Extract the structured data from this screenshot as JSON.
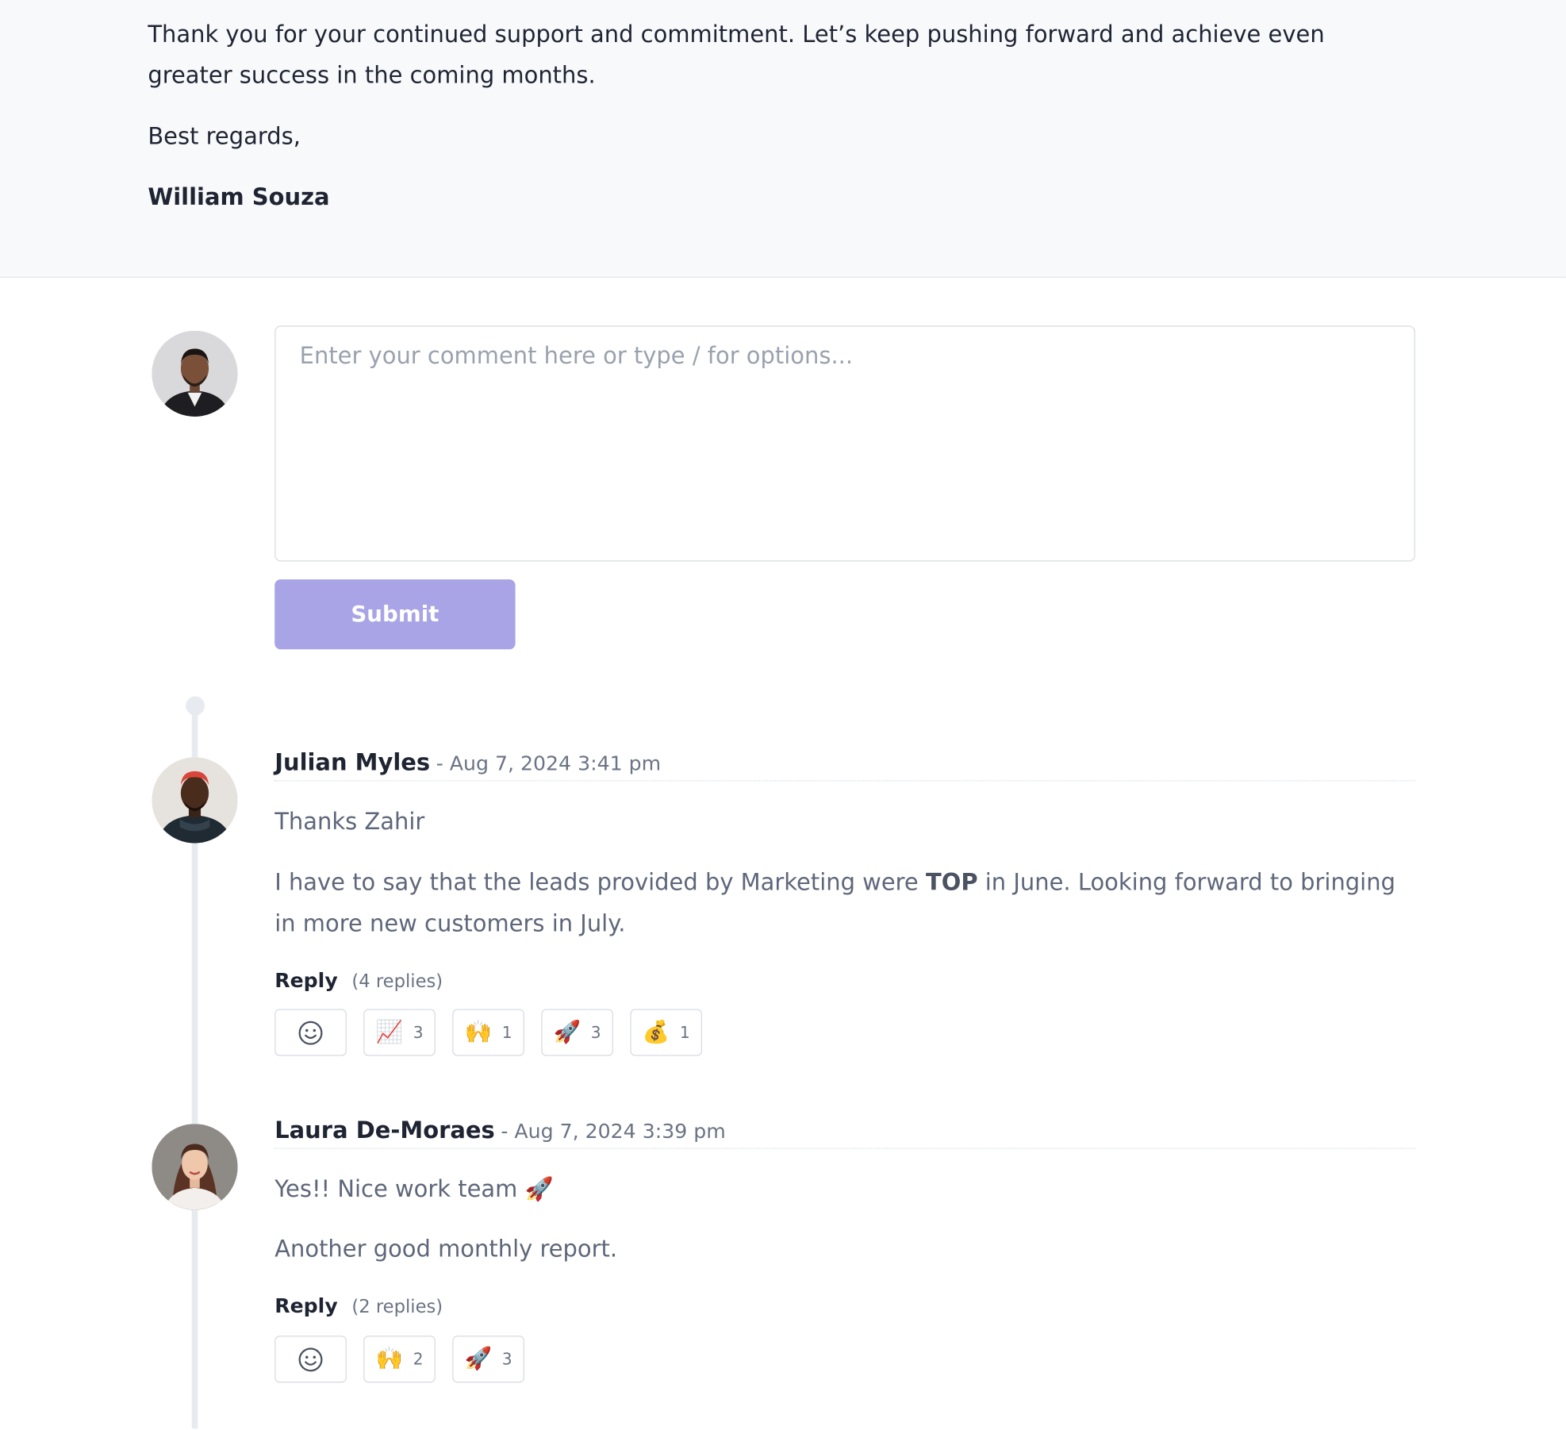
{
  "email": {
    "closing_paragraph": "Thank you for your continued support and commitment. Let’s keep pushing forward and achieve even greater success in the coming months.",
    "regards": "Best regards,",
    "signature": "William Souza"
  },
  "compose": {
    "placeholder": "Enter your comment here or type / for options...",
    "value": "",
    "submit_label": "Submit"
  },
  "comments": [
    {
      "author": "Julian Myles",
      "time": "- Aug 7, 2024 3:41 pm",
      "line1": "Thanks Zahir",
      "line2_before": "I have to say that the leads provided by Marketing were ",
      "line2_bold": "TOP",
      "line2_after": " in June. Looking forward to bringing in more new customers in July.",
      "reply_label": "Reply",
      "replies": "(4 replies)",
      "reactions": [
        {
          "icon": "smile-add-icon",
          "emoji": "",
          "count": ""
        },
        {
          "icon": "chart-increasing-icon",
          "emoji": "📈",
          "count": "3"
        },
        {
          "icon": "raising-hands-icon",
          "emoji": "🙌",
          "count": "1"
        },
        {
          "icon": "rocket-icon",
          "emoji": "🚀",
          "count": "3"
        },
        {
          "icon": "money-bag-icon",
          "emoji": "💰",
          "count": "1"
        }
      ]
    },
    {
      "author": "Laura De-Moraes",
      "time": "- Aug 7, 2024 3:39 pm",
      "line1": "Yes!! Nice work team 🚀",
      "line2": "Another good monthly report.",
      "reply_label": "Reply",
      "replies": "(2 replies)",
      "reactions": [
        {
          "icon": "smile-add-icon",
          "emoji": "",
          "count": ""
        },
        {
          "icon": "raising-hands-icon",
          "emoji": "🙌",
          "count": "2"
        },
        {
          "icon": "rocket-icon",
          "emoji": "🚀",
          "count": "3"
        }
      ]
    }
  ],
  "colors": {
    "accent_button": "#a8a4e6",
    "email_background": "#f8f9fb",
    "thread_line": "#e7eaef"
  }
}
